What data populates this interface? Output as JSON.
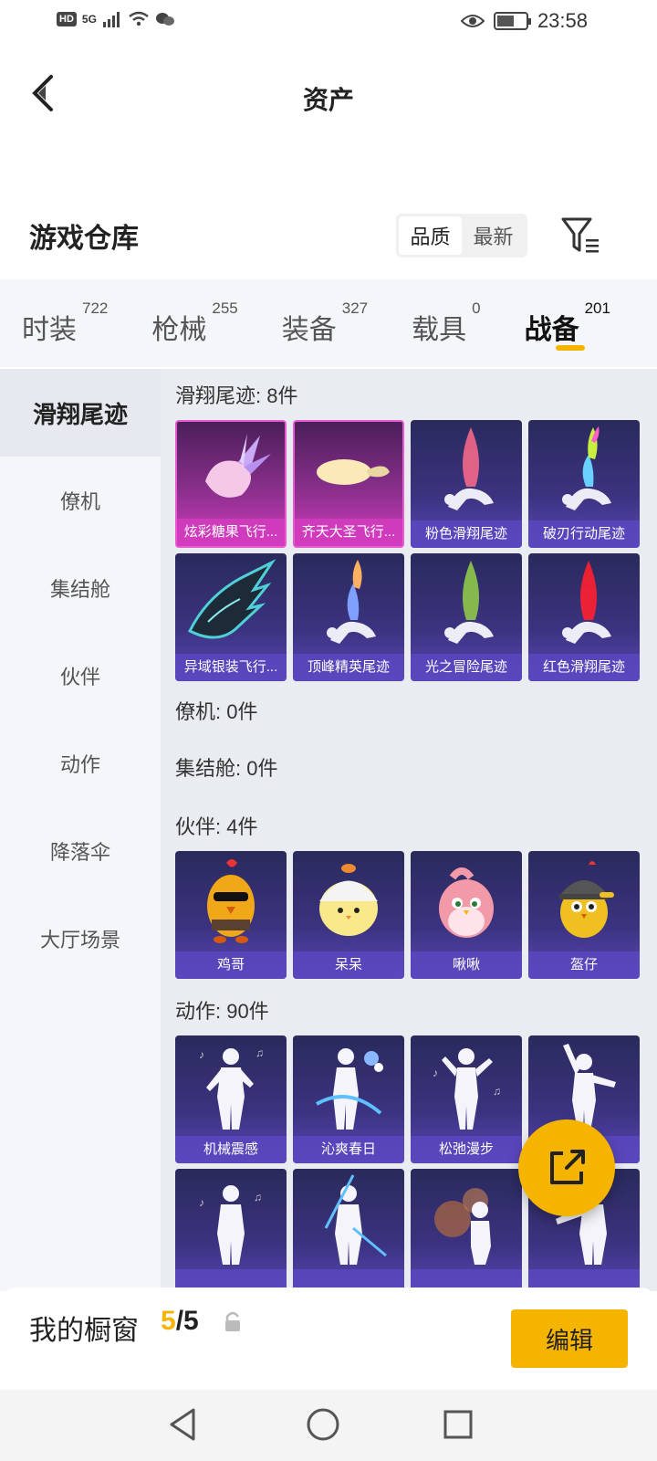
{
  "status": {
    "left_hd": "HD",
    "left_net": "5G",
    "time": "23:58"
  },
  "header": {
    "title": "资产"
  },
  "warehouse": {
    "title": "游戏仓库",
    "sort_options": [
      "品质",
      "最新"
    ],
    "active_sort": "品质"
  },
  "tabs": [
    {
      "label": "时装",
      "count": "722"
    },
    {
      "label": "枪械",
      "count": "255"
    },
    {
      "label": "装备",
      "count": "327"
    },
    {
      "label": "载具",
      "count": "0"
    },
    {
      "label": "战备",
      "count": "201",
      "active": true
    }
  ],
  "sidebar": [
    {
      "label": "滑翔尾迹",
      "active": true
    },
    {
      "label": "僚机"
    },
    {
      "label": "集结舱"
    },
    {
      "label": "伙伴"
    },
    {
      "label": "动作"
    },
    {
      "label": "降落伞"
    },
    {
      "label": "大厅场景"
    }
  ],
  "sections": {
    "trails": {
      "title": "滑翔尾迹: 8件",
      "items": [
        {
          "label": "炫彩糖果飞行...",
          "style": "pink",
          "icon": "candy-icon"
        },
        {
          "label": "齐天大圣飞行...",
          "style": "pink",
          "icon": "cloud-icon"
        },
        {
          "label": "粉色滑翔尾迹",
          "style": "purple",
          "icon": "trail-pink-icon",
          "color": "#ff6b8a"
        },
        {
          "label": "破刃行动尾迹",
          "style": "purple",
          "icon": "trail-rainbow-icon",
          "color": "#c8f040"
        },
        {
          "label": "异域银装飞行...",
          "style": "purple",
          "icon": "wing-icon"
        },
        {
          "label": "顶峰精英尾迹",
          "style": "purple",
          "icon": "trail-elite-icon",
          "color": "#ffb060"
        },
        {
          "label": "光之冒险尾迹",
          "style": "purple",
          "icon": "trail-green-icon",
          "color": "#8fc84a"
        },
        {
          "label": "红色滑翔尾迹",
          "style": "purple",
          "icon": "trail-red-icon",
          "color": "#ff2030"
        }
      ]
    },
    "wingman": {
      "title": "僚机: 0件"
    },
    "pod": {
      "title": "集结舱: 0件"
    },
    "partners": {
      "title": "伙伴: 4件",
      "items": [
        {
          "label": "鸡哥",
          "icon": "chicken-sunglasses-icon"
        },
        {
          "label": "呆呆",
          "icon": "chick-helmet-icon"
        },
        {
          "label": "啾啾",
          "icon": "pink-bird-icon"
        },
        {
          "label": "盔仔",
          "icon": "chick-soldier-icon"
        }
      ]
    },
    "emotes": {
      "title": "动作: 90件",
      "items": [
        {
          "label": "机械震感",
          "icon": "dance-pose-icon"
        },
        {
          "label": "沁爽春日",
          "icon": "dance-swirl-icon"
        },
        {
          "label": "松弛漫步",
          "icon": "dance-relax-icon"
        },
        {
          "label": "",
          "icon": "dance-arms-up-icon"
        },
        {
          "label": "",
          "icon": "dance-pose-icon"
        },
        {
          "label": "",
          "icon": "dance-sword-icon"
        },
        {
          "label": "",
          "icon": "dance-firework-icon"
        },
        {
          "label": "",
          "icon": "dance-lean-icon"
        }
      ]
    }
  },
  "bottom": {
    "label": "我的橱窗",
    "current": "5",
    "total": "/5",
    "edit": "编辑"
  },
  "colors": {
    "accent": "#f5b400",
    "card_purple": "#3b3380",
    "card_pink": "#d23cbf"
  }
}
